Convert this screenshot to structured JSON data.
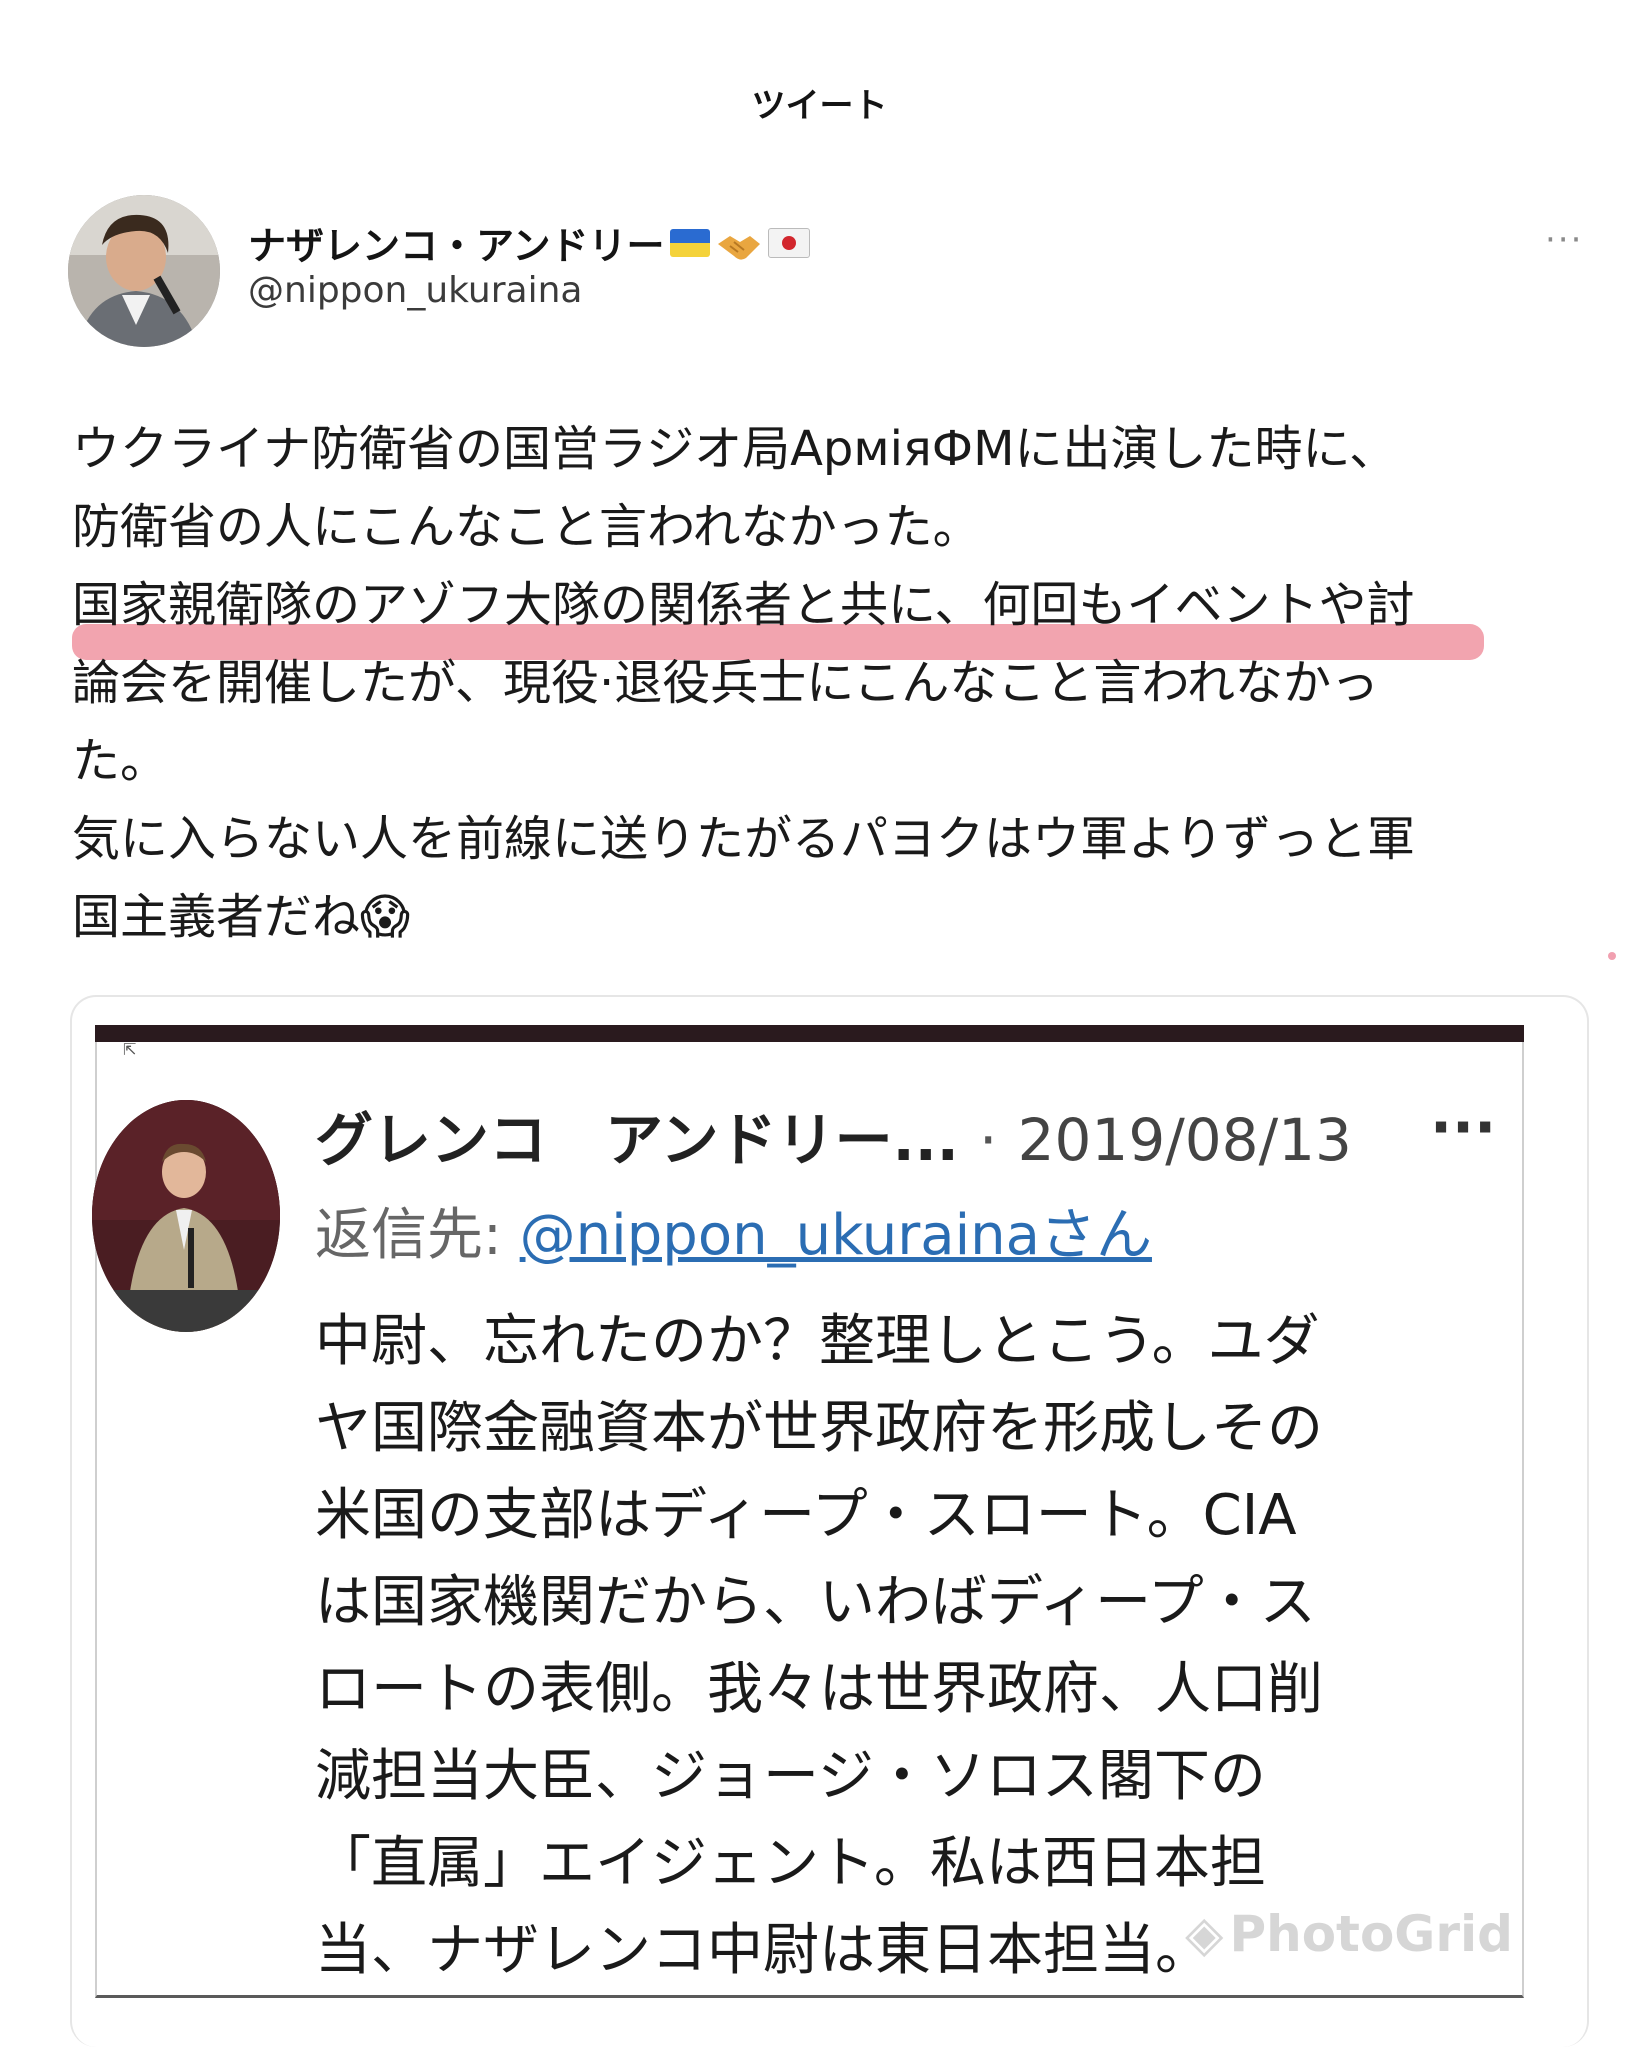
{
  "header": {
    "title": "ツイート"
  },
  "tweet": {
    "display_name": "ナザレンコ・アンドリー",
    "handle": "@nippon_ukuraina",
    "more": "···",
    "lines": [
      "ウクライナ防衛省の国営ラジオ局АрміяФМに出演した時に、",
      "防衛省の人にこんなこと言われなかった。",
      "国家親衛隊のアゾフ大隊の関係者と共に、何回もイベントや討",
      "論会を開催したが、現役·退役兵士にこんなこと言われなかっ",
      "た。",
      "気に入らない人を前線に送りたがるパヨクはウ軍よりずっと軍",
      "国主義者だね😱"
    ]
  },
  "quoted": {
    "display_name": "グレンコ　アンドリー...",
    "separator": "·",
    "date": "2019/08/13",
    "more": "···",
    "reply_prefix": "返信先: ",
    "reply_handle": "@nippon_ukurainaさん",
    "lines": [
      "中尉、忘れたのか？整理しとこう。ユダ",
      "ヤ国際金融資本が世界政府を形成しその",
      "米国の支部はディープ・スロート。CIA",
      "は国家機関だから、いわばディープ・ス",
      "ロートの表側。我々は世界政府、人口削",
      "減担当大臣、ジョージ・ソロス閣下の",
      "「直属」エイジェント。私は西日本担",
      "当、ナザレンコ中尉は東日本担当。"
    ]
  },
  "watermark": "PhotoGrid",
  "colors": {
    "highlight": "#e85a6e",
    "link": "#2b6db3"
  }
}
